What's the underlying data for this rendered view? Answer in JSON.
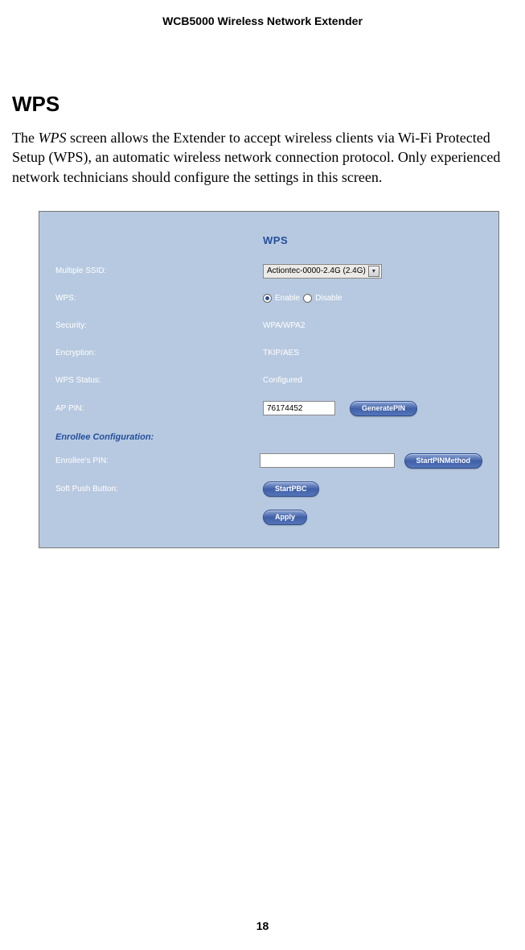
{
  "doc": {
    "header_title": "WCB5000 Wireless Network Extender",
    "section_heading": "WPS",
    "body_prefix": "The ",
    "body_italic": "WPS",
    "body_rest": " screen allows the Extender to accept wireless clients via Wi-Fi Protected Setup (WPS), an automatic wireless network connection protocol. Only experienced network technicians should configure the settings in this screen.",
    "page_number": "18"
  },
  "panel": {
    "title": "WPS",
    "labels": {
      "multiple_ssid": "Multiple SSID:",
      "wps": "WPS:",
      "security": "Security:",
      "encryption": "Encryption:",
      "wps_status": "WPS Status:",
      "ap_pin": "AP PIN:",
      "enrollee_config": "Enrollee Configuration:",
      "enrollee_pin": "Enrollee's PIN:",
      "soft_push": "Soft Push Button:"
    },
    "values": {
      "ssid_selected": "Actiontec-0000-2.4G (2.4G)",
      "wps_enable": "Enable",
      "wps_disable": "Disable",
      "security": "WPA/WPA2",
      "encryption": "TKIP/AES",
      "wps_status": "Configured",
      "ap_pin": "76174452",
      "enrollee_pin": ""
    },
    "buttons": {
      "generate_pin": "GeneratePIN",
      "start_pin": "StartPINMethod",
      "start_pbc": "StartPBC",
      "apply": "Apply"
    }
  }
}
